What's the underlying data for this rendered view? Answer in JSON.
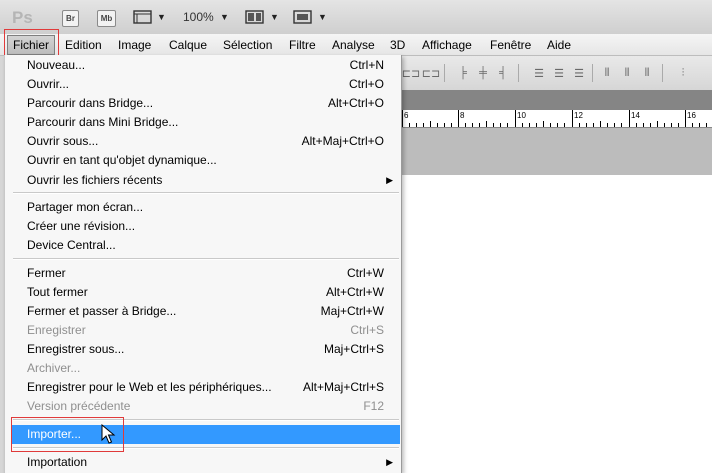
{
  "app": {
    "logo": "Ps",
    "bridge_label": "Br",
    "minibridge_label": "Mb",
    "zoom": "100%"
  },
  "menubar": {
    "items": [
      "Fichier",
      "Edition",
      "Image",
      "Calque",
      "Sélection",
      "Filtre",
      "Analyse",
      "3D",
      "Affichage",
      "Fenêtre",
      "Aide"
    ]
  },
  "ruler": {
    "labels": [
      "6",
      "8",
      "10",
      "12",
      "14",
      "16"
    ]
  },
  "menu": {
    "items": [
      {
        "label": "Nouveau...",
        "shortcut": "Ctrl+N"
      },
      {
        "label": "Ouvrir...",
        "shortcut": "Ctrl+O"
      },
      {
        "label": "Parcourir dans Bridge...",
        "shortcut": "Alt+Ctrl+O"
      },
      {
        "label": "Parcourir dans Mini Bridge...",
        "shortcut": ""
      },
      {
        "label": "Ouvrir sous...",
        "shortcut": "Alt+Maj+Ctrl+O"
      },
      {
        "label": "Ouvrir en tant qu'objet dynamique...",
        "shortcut": ""
      },
      {
        "label": "Ouvrir les fichiers récents",
        "shortcut": ""
      },
      {
        "label": "Partager mon écran...",
        "shortcut": ""
      },
      {
        "label": "Créer une révision...",
        "shortcut": ""
      },
      {
        "label": "Device Central...",
        "shortcut": ""
      },
      {
        "label": "Fermer",
        "shortcut": "Ctrl+W"
      },
      {
        "label": "Tout fermer",
        "shortcut": "Alt+Ctrl+W"
      },
      {
        "label": "Fermer et passer à Bridge...",
        "shortcut": "Maj+Ctrl+W"
      },
      {
        "label": "Enregistrer",
        "shortcut": "Ctrl+S"
      },
      {
        "label": "Enregistrer sous...",
        "shortcut": "Maj+Ctrl+S"
      },
      {
        "label": "Archiver...",
        "shortcut": ""
      },
      {
        "label": "Enregistrer pour le Web et les périphériques...",
        "shortcut": "Alt+Maj+Ctrl+S"
      },
      {
        "label": "Version précédente",
        "shortcut": "F12"
      },
      {
        "label": "Importer...",
        "shortcut": ""
      },
      {
        "label": "Importation",
        "shortcut": ""
      }
    ]
  }
}
